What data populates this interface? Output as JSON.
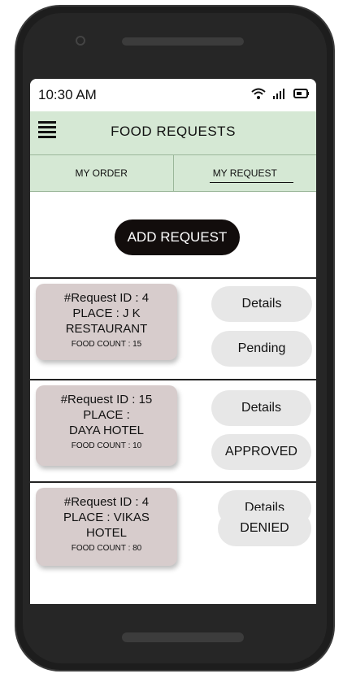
{
  "status": {
    "time": "10:30 AM"
  },
  "header": {
    "title": "FOOD REQUESTS"
  },
  "tabs": [
    {
      "label": "MY ORDER",
      "active": false
    },
    {
      "label": "MY REQUEST",
      "active": true
    }
  ],
  "actions": {
    "add_request": "ADD REQUEST"
  },
  "requests": [
    {
      "id_line": "#Request ID : 4",
      "place_line_1": "PLACE : J K",
      "place_line_2": "RESTAURANT",
      "food_count": "FOOD COUNT : 15",
      "details_label": "Details",
      "status_label": "Pending"
    },
    {
      "id_line": "#Request ID : 15",
      "place_line_1": "PLACE :",
      "place_line_2": "DAYA HOTEL",
      "food_count": "FOOD COUNT : 10",
      "details_label": "Details",
      "status_label": "APPROVED"
    },
    {
      "id_line": "#Request ID : 4",
      "place_line_1": "PLACE : VIKAS",
      "place_line_2": "HOTEL",
      "food_count": "FOOD COUNT : 80",
      "details_label": "Details",
      "status_label": "DENIED"
    }
  ],
  "colors": {
    "header_bg": "#d5e8d4",
    "card_bg": "#d7cccc",
    "pill_bg": "#e7e7e7",
    "button_bg": "#120d0c"
  },
  "icons": [
    "menu-icon",
    "wifi-icon",
    "signal-icon",
    "battery-icon"
  ]
}
